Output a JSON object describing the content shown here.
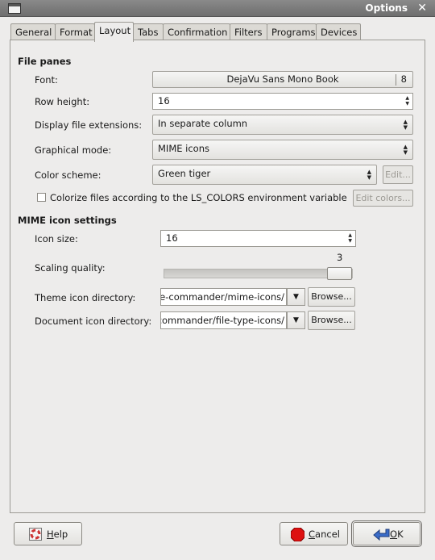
{
  "window": {
    "title": "Options",
    "close_icon": "close-icon"
  },
  "tabs": [
    "General",
    "Format",
    "Layout",
    "Tabs",
    "Confirmation",
    "Filters",
    "Programs",
    "Devices"
  ],
  "active_tab": "Layout",
  "file_panes": {
    "heading": "File panes",
    "font_label": "Font:",
    "font_name": "DejaVu Sans Mono Book",
    "font_size": "8",
    "row_height_label": "Row height:",
    "row_height_value": "16",
    "extensions_label": "Display file extensions:",
    "extensions_value": "In separate column",
    "graphical_label": "Graphical mode:",
    "graphical_value": "MIME icons",
    "scheme_label": "Color scheme:",
    "scheme_value": "Green tiger",
    "edit_button": "Edit...",
    "colorize_label": "Colorize files according to the LS_COLORS environment variable",
    "colorize_checked": false,
    "edit_colors_button": "Edit colors..."
  },
  "mime": {
    "heading": "MIME icon settings",
    "icon_size_label": "Icon size:",
    "icon_size_value": "16",
    "scaling_label": "Scaling quality:",
    "scaling_value": "3",
    "scaling_fraction": 1.0,
    "theme_dir_label": "Theme icon directory:",
    "theme_dir_value": "/usr/share/gnome-commander/mime-icons",
    "doc_dir_label": "Document icon directory:",
    "doc_dir_value": "/usr/share/gnome-commander/file-type-icons",
    "browse_button": "Browse..."
  },
  "footer": {
    "help": "Help",
    "cancel": "Cancel",
    "ok": "OK"
  },
  "colors": {
    "cancel_icon": "#dd1111",
    "ok_icon": "#3a6cc8",
    "help_icon": "#cc3333"
  }
}
